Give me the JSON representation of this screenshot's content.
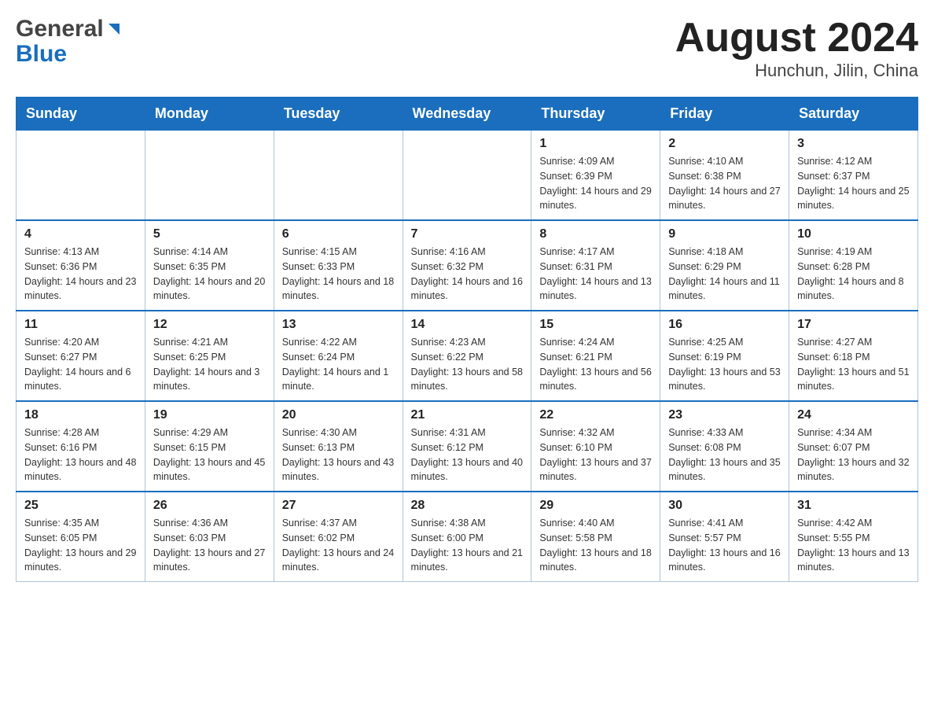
{
  "header": {
    "logo_general": "General",
    "logo_blue": "Blue",
    "month_title": "August 2024",
    "location": "Hunchun, Jilin, China"
  },
  "weekdays": [
    "Sunday",
    "Monday",
    "Tuesday",
    "Wednesday",
    "Thursday",
    "Friday",
    "Saturday"
  ],
  "weeks": [
    [
      {
        "day": "",
        "sunrise": "",
        "sunset": "",
        "daylight": ""
      },
      {
        "day": "",
        "sunrise": "",
        "sunset": "",
        "daylight": ""
      },
      {
        "day": "",
        "sunrise": "",
        "sunset": "",
        "daylight": ""
      },
      {
        "day": "",
        "sunrise": "",
        "sunset": "",
        "daylight": ""
      },
      {
        "day": "1",
        "sunrise": "Sunrise: 4:09 AM",
        "sunset": "Sunset: 6:39 PM",
        "daylight": "Daylight: 14 hours and 29 minutes."
      },
      {
        "day": "2",
        "sunrise": "Sunrise: 4:10 AM",
        "sunset": "Sunset: 6:38 PM",
        "daylight": "Daylight: 14 hours and 27 minutes."
      },
      {
        "day": "3",
        "sunrise": "Sunrise: 4:12 AM",
        "sunset": "Sunset: 6:37 PM",
        "daylight": "Daylight: 14 hours and 25 minutes."
      }
    ],
    [
      {
        "day": "4",
        "sunrise": "Sunrise: 4:13 AM",
        "sunset": "Sunset: 6:36 PM",
        "daylight": "Daylight: 14 hours and 23 minutes."
      },
      {
        "day": "5",
        "sunrise": "Sunrise: 4:14 AM",
        "sunset": "Sunset: 6:35 PM",
        "daylight": "Daylight: 14 hours and 20 minutes."
      },
      {
        "day": "6",
        "sunrise": "Sunrise: 4:15 AM",
        "sunset": "Sunset: 6:33 PM",
        "daylight": "Daylight: 14 hours and 18 minutes."
      },
      {
        "day": "7",
        "sunrise": "Sunrise: 4:16 AM",
        "sunset": "Sunset: 6:32 PM",
        "daylight": "Daylight: 14 hours and 16 minutes."
      },
      {
        "day": "8",
        "sunrise": "Sunrise: 4:17 AM",
        "sunset": "Sunset: 6:31 PM",
        "daylight": "Daylight: 14 hours and 13 minutes."
      },
      {
        "day": "9",
        "sunrise": "Sunrise: 4:18 AM",
        "sunset": "Sunset: 6:29 PM",
        "daylight": "Daylight: 14 hours and 11 minutes."
      },
      {
        "day": "10",
        "sunrise": "Sunrise: 4:19 AM",
        "sunset": "Sunset: 6:28 PM",
        "daylight": "Daylight: 14 hours and 8 minutes."
      }
    ],
    [
      {
        "day": "11",
        "sunrise": "Sunrise: 4:20 AM",
        "sunset": "Sunset: 6:27 PM",
        "daylight": "Daylight: 14 hours and 6 minutes."
      },
      {
        "day": "12",
        "sunrise": "Sunrise: 4:21 AM",
        "sunset": "Sunset: 6:25 PM",
        "daylight": "Daylight: 14 hours and 3 minutes."
      },
      {
        "day": "13",
        "sunrise": "Sunrise: 4:22 AM",
        "sunset": "Sunset: 6:24 PM",
        "daylight": "Daylight: 14 hours and 1 minute."
      },
      {
        "day": "14",
        "sunrise": "Sunrise: 4:23 AM",
        "sunset": "Sunset: 6:22 PM",
        "daylight": "Daylight: 13 hours and 58 minutes."
      },
      {
        "day": "15",
        "sunrise": "Sunrise: 4:24 AM",
        "sunset": "Sunset: 6:21 PM",
        "daylight": "Daylight: 13 hours and 56 minutes."
      },
      {
        "day": "16",
        "sunrise": "Sunrise: 4:25 AM",
        "sunset": "Sunset: 6:19 PM",
        "daylight": "Daylight: 13 hours and 53 minutes."
      },
      {
        "day": "17",
        "sunrise": "Sunrise: 4:27 AM",
        "sunset": "Sunset: 6:18 PM",
        "daylight": "Daylight: 13 hours and 51 minutes."
      }
    ],
    [
      {
        "day": "18",
        "sunrise": "Sunrise: 4:28 AM",
        "sunset": "Sunset: 6:16 PM",
        "daylight": "Daylight: 13 hours and 48 minutes."
      },
      {
        "day": "19",
        "sunrise": "Sunrise: 4:29 AM",
        "sunset": "Sunset: 6:15 PM",
        "daylight": "Daylight: 13 hours and 45 minutes."
      },
      {
        "day": "20",
        "sunrise": "Sunrise: 4:30 AM",
        "sunset": "Sunset: 6:13 PM",
        "daylight": "Daylight: 13 hours and 43 minutes."
      },
      {
        "day": "21",
        "sunrise": "Sunrise: 4:31 AM",
        "sunset": "Sunset: 6:12 PM",
        "daylight": "Daylight: 13 hours and 40 minutes."
      },
      {
        "day": "22",
        "sunrise": "Sunrise: 4:32 AM",
        "sunset": "Sunset: 6:10 PM",
        "daylight": "Daylight: 13 hours and 37 minutes."
      },
      {
        "day": "23",
        "sunrise": "Sunrise: 4:33 AM",
        "sunset": "Sunset: 6:08 PM",
        "daylight": "Daylight: 13 hours and 35 minutes."
      },
      {
        "day": "24",
        "sunrise": "Sunrise: 4:34 AM",
        "sunset": "Sunset: 6:07 PM",
        "daylight": "Daylight: 13 hours and 32 minutes."
      }
    ],
    [
      {
        "day": "25",
        "sunrise": "Sunrise: 4:35 AM",
        "sunset": "Sunset: 6:05 PM",
        "daylight": "Daylight: 13 hours and 29 minutes."
      },
      {
        "day": "26",
        "sunrise": "Sunrise: 4:36 AM",
        "sunset": "Sunset: 6:03 PM",
        "daylight": "Daylight: 13 hours and 27 minutes."
      },
      {
        "day": "27",
        "sunrise": "Sunrise: 4:37 AM",
        "sunset": "Sunset: 6:02 PM",
        "daylight": "Daylight: 13 hours and 24 minutes."
      },
      {
        "day": "28",
        "sunrise": "Sunrise: 4:38 AM",
        "sunset": "Sunset: 6:00 PM",
        "daylight": "Daylight: 13 hours and 21 minutes."
      },
      {
        "day": "29",
        "sunrise": "Sunrise: 4:40 AM",
        "sunset": "Sunset: 5:58 PM",
        "daylight": "Daylight: 13 hours and 18 minutes."
      },
      {
        "day": "30",
        "sunrise": "Sunrise: 4:41 AM",
        "sunset": "Sunset: 5:57 PM",
        "daylight": "Daylight: 13 hours and 16 minutes."
      },
      {
        "day": "31",
        "sunrise": "Sunrise: 4:42 AM",
        "sunset": "Sunset: 5:55 PM",
        "daylight": "Daylight: 13 hours and 13 minutes."
      }
    ]
  ]
}
